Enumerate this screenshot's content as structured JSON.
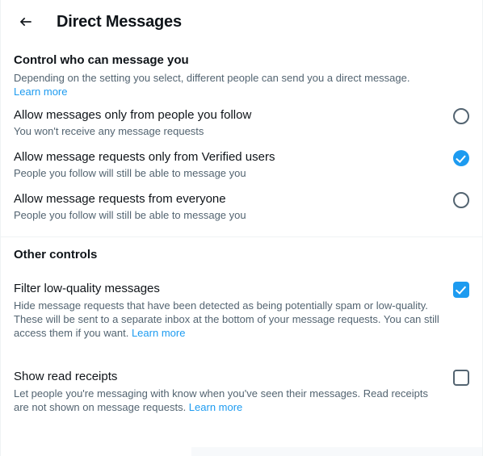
{
  "header": {
    "back_icon": "arrow-left-icon",
    "title": "Direct Messages"
  },
  "sections": [
    {
      "title": "Control who can message you",
      "description": "Depending on the setting you select, different people can send you a direct message.",
      "learn_more": "Learn more",
      "options": [
        {
          "label": "Allow messages only from people you follow",
          "sublabel": "You won't receive any message requests",
          "selected": false
        },
        {
          "label": "Allow message requests only from Verified users",
          "sublabel": "People you follow will still be able to message you",
          "selected": true
        },
        {
          "label": "Allow message requests from everyone",
          "sublabel": "People you follow will still be able to message you",
          "selected": false
        }
      ]
    },
    {
      "title": "Other controls",
      "controls": [
        {
          "label": "Filter low-quality messages",
          "description": "Hide message requests that have been detected as being potentially spam or low-quality. These will be sent to a separate inbox at the bottom of your message requests. You can still access them if you want. ",
          "learn_more": "Learn more",
          "checked": true
        },
        {
          "label": "Show read receipts",
          "description": "Let people you're messaging with know when you've seen their messages. Read receipts are not shown on message requests. ",
          "learn_more": "Learn more",
          "checked": false
        }
      ]
    }
  ],
  "colors": {
    "accent": "#1d9bf0",
    "text_primary": "#0f1419",
    "text_secondary": "#536471",
    "border": "#cfd9de",
    "divider": "#eff3f4",
    "background": "#ffffff"
  }
}
